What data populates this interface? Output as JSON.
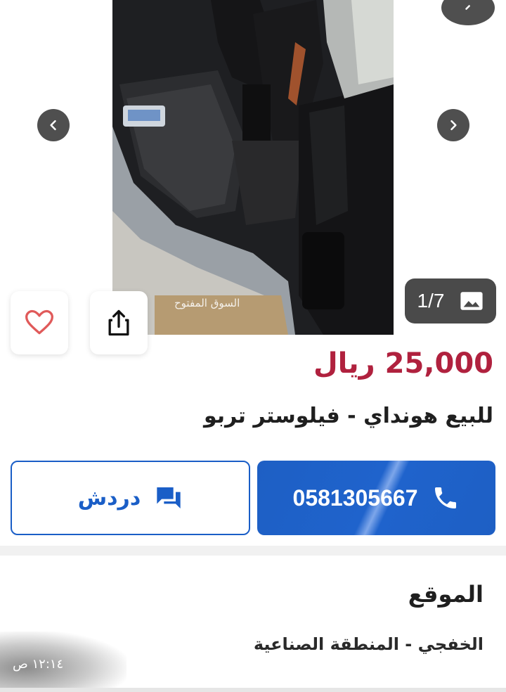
{
  "listing": {
    "price": "25,000 ريال",
    "title": "للبيع هونداي - فيلوستر تربو"
  },
  "gallery": {
    "counter": "1/7",
    "watermark": "السوق المفتوح opensooq",
    "icons": {
      "prev": "chevron-left-icon",
      "next": "chevron-right-icon",
      "counter": "image-icon",
      "favorite": "heart-icon",
      "share": "share-icon"
    }
  },
  "actions": {
    "call_number": "0581305667",
    "chat_label": "دردش"
  },
  "location": {
    "heading": "الموقع",
    "value": "الخفجي - المنطقة الصناعية"
  },
  "status": {
    "time": "١٢:١٤ ص"
  },
  "colors": {
    "price": "#b0213e",
    "primary": "#1a5ec7",
    "arrow_bg": "#4f4f4f"
  }
}
